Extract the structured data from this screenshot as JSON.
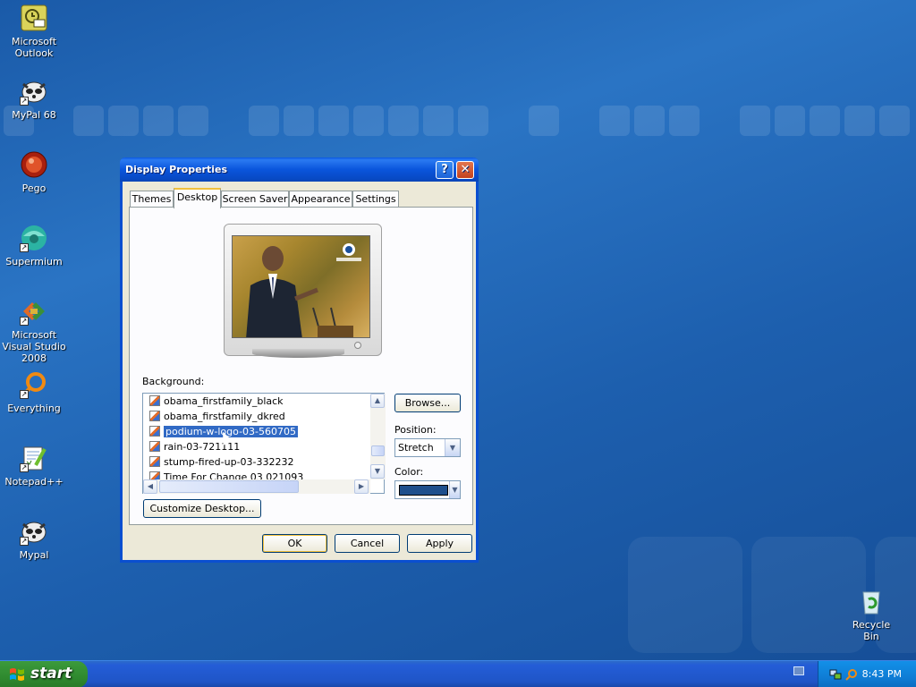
{
  "desktop": {
    "icons": [
      {
        "label": "Microsoft Outlook",
        "icon": "outlook-icon",
        "shortcut": false
      },
      {
        "label": "MyPal 68",
        "icon": "mypal-icon",
        "shortcut": true
      },
      {
        "label": "Pego",
        "icon": "pego-icon",
        "shortcut": false
      },
      {
        "label": "Supermium",
        "icon": "supermium-icon",
        "shortcut": true
      },
      {
        "label": "Microsoft Visual Studio 2008",
        "icon": "visual-studio-icon",
        "shortcut": true
      },
      {
        "label": "Everything",
        "icon": "everything-icon",
        "shortcut": true
      },
      {
        "label": "Notepad++",
        "icon": "notepadpp-icon",
        "shortcut": true
      },
      {
        "label": "Mypal",
        "icon": "mypal-icon",
        "shortcut": true
      }
    ],
    "recycle_bin": "Recycle Bin"
  },
  "dialog": {
    "title": "Display Properties",
    "help": "?",
    "close": "✕",
    "tabs": [
      "Themes",
      "Desktop",
      "Screen Saver",
      "Appearance",
      "Settings"
    ],
    "active_tab": "Desktop",
    "background_label": "Background:",
    "backgrounds": [
      "obama_firstfamily_black",
      "obama_firstfamily_dkred",
      "podium-w-logo-03-560705",
      "rain-03-721111",
      "stump-fired-up-03-332232",
      "Time For Change 03 021093"
    ],
    "selected_background": "podium-w-logo-03-560705",
    "browse": "Browse...",
    "position_label": "Position:",
    "position_value": "Stretch",
    "color_label": "Color:",
    "color_value": "#1e4f8c",
    "customize": "Customize Desktop...",
    "ok": "OK",
    "cancel": "Cancel",
    "apply": "Apply"
  },
  "taskbar": {
    "start": "start",
    "clock": "8:43 PM"
  }
}
